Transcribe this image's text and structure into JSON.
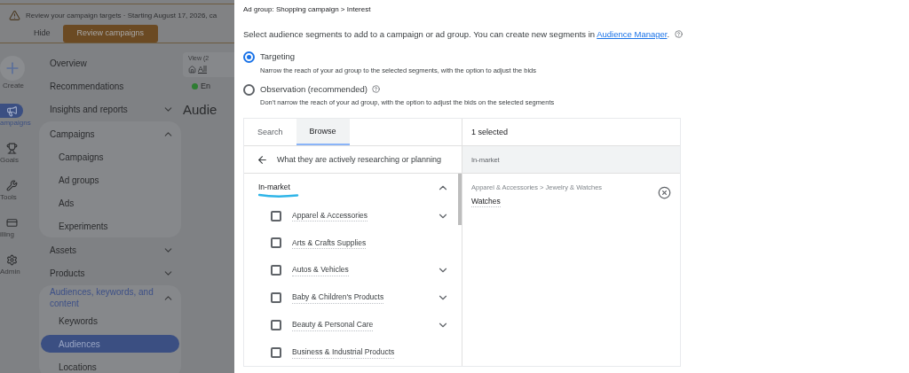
{
  "background": {
    "banner": {
      "text": "Review your campaign targets · Starting August 17, 2026, ca",
      "hide": "Hide",
      "action": "Review campaigns"
    },
    "rail": [
      {
        "kind": "create",
        "label": "Create",
        "selected": false
      },
      {
        "kind": "campaigns",
        "label": "ampaigns",
        "selected": true
      },
      {
        "kind": "goals",
        "label": "Goals",
        "selected": false
      },
      {
        "kind": "tools",
        "label": "Tools",
        "selected": false
      },
      {
        "kind": "billing",
        "label": "illing",
        "selected": false
      },
      {
        "kind": "admin",
        "label": "Admin",
        "selected": false
      }
    ],
    "nav": [
      {
        "label": "Overview"
      },
      {
        "label": "Recommendations"
      },
      {
        "label": "Insights and reports",
        "expanded": false
      },
      {
        "label": "Campaigns",
        "expanded": true,
        "children": [
          {
            "label": "Campaigns",
            "selected": false
          },
          {
            "label": "Ad groups",
            "selected": false
          },
          {
            "label": "Ads",
            "selected": false
          },
          {
            "label": "Experiments",
            "selected": false
          }
        ]
      },
      {
        "label": "Assets",
        "expanded": false
      },
      {
        "label": "Products",
        "expanded": false
      },
      {
        "label": "Audiences, keywords, and content",
        "expanded": true,
        "children": [
          {
            "label": "Keywords",
            "selected": false
          },
          {
            "label": "Audiences",
            "selected": true
          },
          {
            "label": "Locations",
            "selected": false
          }
        ]
      }
    ],
    "content": {
      "view_label": "View (2",
      "view_link": "All",
      "status": "En",
      "heading": "Audie"
    }
  },
  "panel": {
    "breadcrumb": "Ad group: Shopping campaign > Interest",
    "description": "Select audience segments to add to a campaign or ad group. You can create new segments in ",
    "description_link": "Audience Manager",
    "description_end": ".",
    "modes": [
      {
        "label": "Targeting",
        "hint": "Narrow the reach of your ad group to the selected segments, with the option to adjust the bids",
        "selected": true,
        "help": false
      },
      {
        "label": "Observation (recommended)",
        "hint": "Don't narrow the reach of your ad group, with the option to adjust the bids on the selected segments",
        "selected": false,
        "help": true
      }
    ],
    "tabs": [
      {
        "label": "Search",
        "selected": false
      },
      {
        "label": "Browse",
        "selected": true
      }
    ],
    "back_title": "What they are actively researching or planning",
    "group": {
      "label": "In-market",
      "expanded": true,
      "annotated": true
    },
    "items": [
      {
        "label": "Apparel & Accessories",
        "checked": false,
        "has_children": true
      },
      {
        "label": "Arts & Crafts Supplies",
        "checked": false,
        "has_children": false
      },
      {
        "label": "Autos & Vehicles",
        "checked": false,
        "has_children": true
      },
      {
        "label": "Baby & Children's Products",
        "checked": false,
        "has_children": true
      },
      {
        "label": "Beauty & Personal Care",
        "checked": false,
        "has_children": true
      },
      {
        "label": "Business & Industrial Products",
        "checked": false,
        "has_children": false
      }
    ],
    "selected_count": "1 selected",
    "selected_group": "In-market",
    "selected_items": [
      {
        "path": "Apparel & Accessories > Jewelry & Watches",
        "label": "Watches"
      }
    ]
  }
}
